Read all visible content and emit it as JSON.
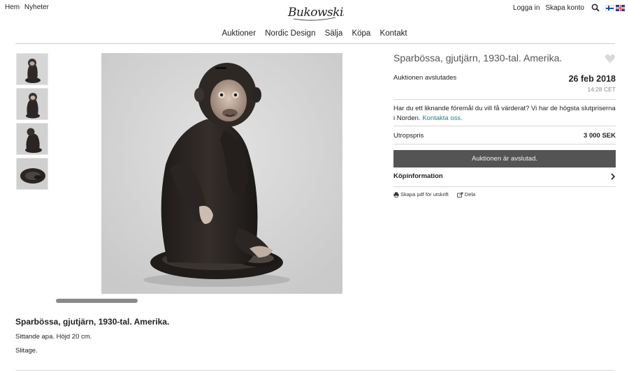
{
  "top_nav": {
    "left_links": [
      "Hem",
      "Nyheter"
    ],
    "logo_text": "Bukowskis",
    "login": "Logga in",
    "create_account": "Skapa konto",
    "search_icon": "search-icon",
    "flags": [
      "flag-finland-icon",
      "flag-uk-icon"
    ]
  },
  "main_nav": [
    "Auktioner",
    "Nordic Design",
    "Sälja",
    "Köpa",
    "Kontakt"
  ],
  "gallery": {
    "thumbnail_count": 4,
    "main_image_alt": "cast iron monkey coin bank"
  },
  "item": {
    "title": "Sparbössa, gjutjärn, 1930-tal. Amerika.",
    "ends_label": "Auktionen avslutades",
    "ends_date": "26 feb 2018",
    "ends_time": "14:28 CET",
    "valuation_text": "Har du ett liknande föremål du vill få värderat? Vi har de högsta slutpriserna i Norden.",
    "valuation_link": "Kontakta oss.",
    "price_label": "Utropspris",
    "price_value": "3 000 SEK",
    "status_button": "Auktionen är avslutad.",
    "buy_info": "Köpinformation",
    "pdf_action": "Skapa pdf för utskrift",
    "share_action": "Dela"
  },
  "description": {
    "title": "Sparbössa, gjutjärn, 1930-tal. Amerika.",
    "lines": [
      "Sittande apa. Höjd 20 cm.",
      "Slitage."
    ]
  },
  "colors": {
    "button_bg": "#545454",
    "link": "#2a7f8f",
    "rule": "#d6d6d6"
  }
}
